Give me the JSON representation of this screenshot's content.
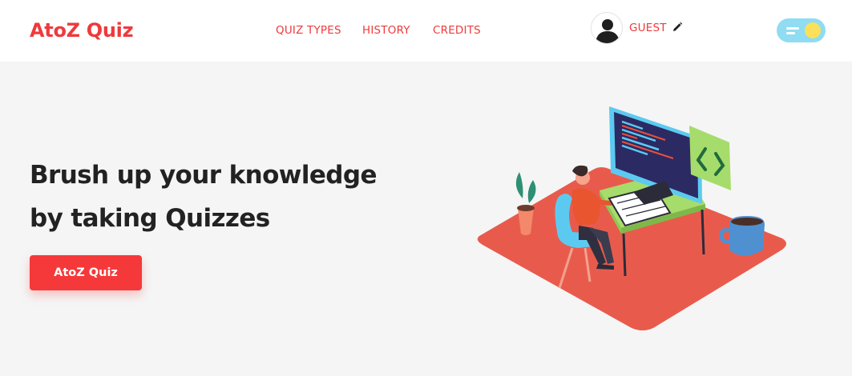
{
  "header": {
    "brand": "AtoZ Quiz",
    "nav": [
      "QUIZ TYPES",
      "HISTORY",
      "CREDITS"
    ],
    "user": {
      "name": "GUEST"
    },
    "theme_toggle": {
      "state": "light"
    }
  },
  "hero": {
    "line1": "Brush up your knowledge",
    "line2_prefix": "by taking ",
    "line2_bold": "Quizzes",
    "cta_label": "AtoZ Quiz"
  },
  "colors": {
    "brand_red": "#ee3a3c",
    "button_red": "#f5393a",
    "page_bg": "#f5f5f5",
    "toggle_bg": "#8fdcf3",
    "toggle_knob": "#fbe05b"
  },
  "icons": {
    "avatar": "user-avatar-icon",
    "edit": "pencil-icon",
    "theme": "theme-toggle-icon"
  }
}
